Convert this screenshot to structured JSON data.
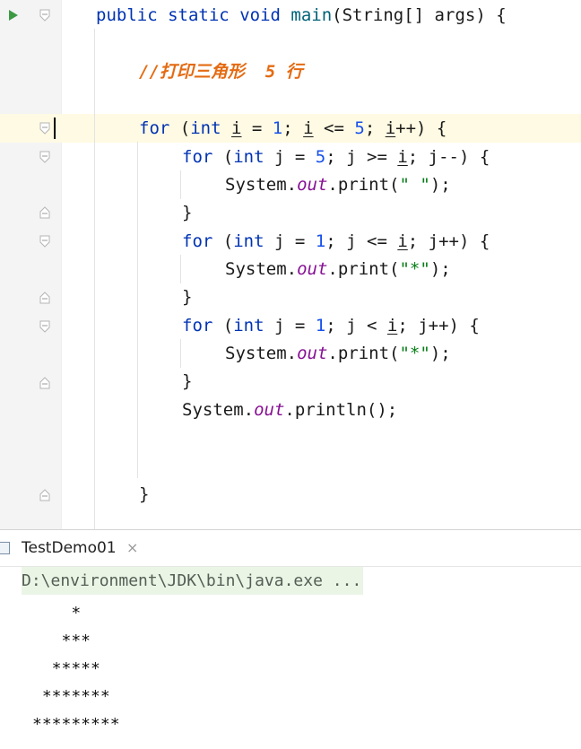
{
  "editor": {
    "lines": {
      "l1": {
        "kw1": "public",
        "kw2": "static",
        "kw3": "void",
        "method": "main",
        "args": "(String[] args) {"
      },
      "comment": "//打印三角形  5 行",
      "outer_for": {
        "kw": "for",
        "p1": "(",
        "kw_int": "int",
        "var": "i",
        "eq": " = ",
        "n1": "1",
        "sep1": "; ",
        "cond_var": "i",
        "cond_op": " <= ",
        "n2": "5",
        "sep2": "; ",
        "inc_var": "i",
        "inc_op": "++) {"
      },
      "inner1": {
        "kw": "for",
        "p1": "(",
        "kw_int": "int",
        "var": "j",
        "eq": " = ",
        "n1": "5",
        "sep1": "; j >= ",
        "cond_var": "i",
        "rest": "; j--) {"
      },
      "print1": {
        "obj": "System.",
        "fld": "out",
        "call": ".print(",
        "str": "\" \"",
        "end": ");"
      },
      "close1": "}",
      "inner2": {
        "kw": "for",
        "p1": "(",
        "kw_int": "int",
        "var": "j",
        "eq": " = ",
        "n1": "1",
        "sep1": "; j <= ",
        "cond_var": "i",
        "rest": "; j++) {"
      },
      "print2": {
        "obj": "System.",
        "fld": "out",
        "call": ".print(",
        "str": "\"*\"",
        "end": ");"
      },
      "close2": "}",
      "inner3": {
        "kw": "for",
        "p1": "(",
        "kw_int": "int",
        "var": "j",
        "eq": " = ",
        "n1": "1",
        "sep1": "; j < ",
        "cond_var": "i",
        "rest": "; j++) {"
      },
      "print3": {
        "obj": "System.",
        "fld": "out",
        "call": ".print(",
        "str": "\"*\"",
        "end": ");"
      },
      "close3": "}",
      "println": {
        "obj": "System.",
        "fld": "out",
        "call": ".println();"
      },
      "close_outer": "}"
    }
  },
  "run": {
    "tab_label": "TestDemo01",
    "close_glyph": "×",
    "command": "D:\\environment\\JDK\\bin\\java.exe ...",
    "output": [
      "    *",
      "   ***",
      "  *****",
      " *******",
      "*********"
    ]
  },
  "colors": {
    "keyword": "#0033b3",
    "number": "#1750eb",
    "string": "#067d17",
    "field": "#871094",
    "comment": "#e46b13",
    "run_icon": "#3c9a45"
  }
}
